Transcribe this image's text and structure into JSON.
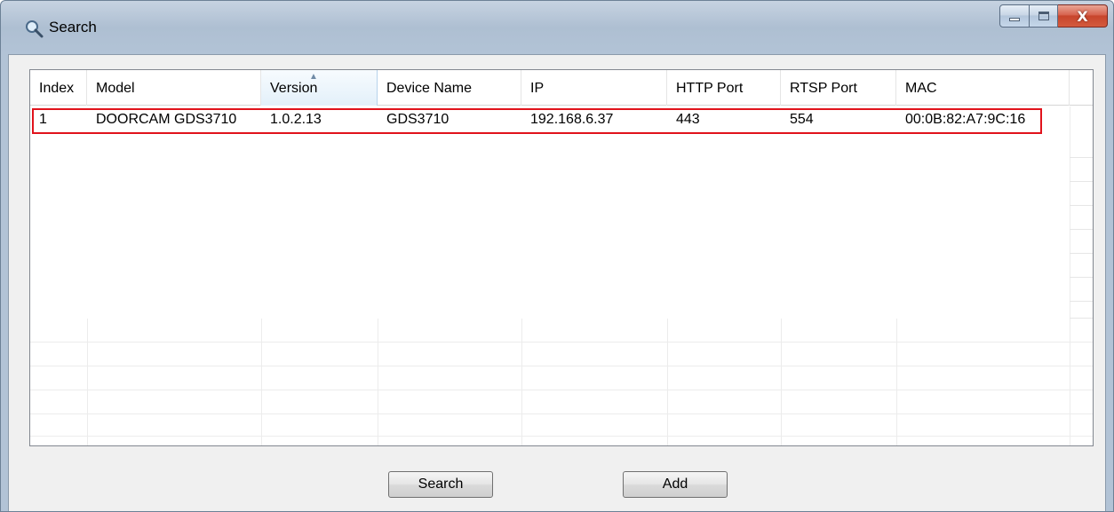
{
  "window": {
    "title": "Search",
    "close_glyph": "X"
  },
  "icons": {
    "title": "magnifier-icon",
    "minimize": "minimize-icon",
    "maximize": "maximize-icon",
    "close": "close-icon",
    "sort": "sort-ascending-icon"
  },
  "table": {
    "columns": [
      "Index",
      "Model",
      "Version",
      "Device Name",
      "IP",
      "HTTP Port",
      "RTSP Port",
      "MAC"
    ],
    "sorted_column": "Version",
    "rows": [
      [
        "1",
        "DOORCAM GDS3710",
        "1.0.2.13",
        "GDS3710",
        "192.168.6.37",
        "443",
        "554",
        "00:0B:82:A7:9C:16"
      ]
    ]
  },
  "buttons": {
    "search": "Search",
    "add": "Add"
  },
  "colors": {
    "highlight": "#e1131c",
    "close_button": "#c7452c",
    "title_bar": "#b2c3d6"
  }
}
